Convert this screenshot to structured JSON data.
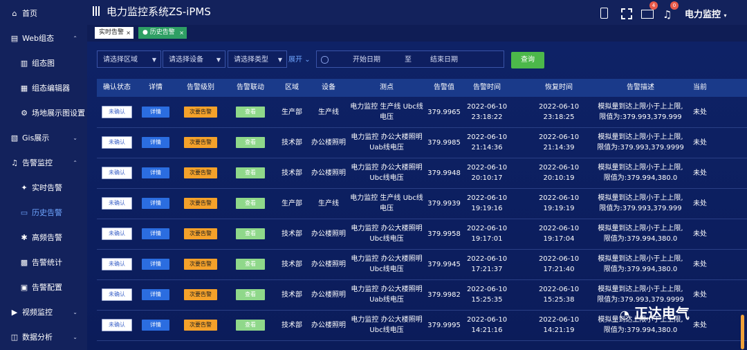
{
  "app_title": "电力监控系统ZS-iPMS",
  "user": "电力监控",
  "mail_badge": "4",
  "bell_badge": "0",
  "nav": [
    {
      "label": "首页",
      "icon": "home-icon",
      "sym": "⌂",
      "level": 0
    },
    {
      "label": "Web组态",
      "icon": "web-config-icon",
      "sym": "▤",
      "level": 0,
      "chev": "⌃"
    },
    {
      "label": "组态图",
      "icon": "diagram-icon",
      "sym": "▥",
      "level": 1
    },
    {
      "label": "组态编辑器",
      "icon": "editor-icon",
      "sym": "▦",
      "level": 1
    },
    {
      "label": "场地展示图设置",
      "icon": "gear-icon",
      "sym": "⚙",
      "level": 1
    },
    {
      "label": "Gis展示",
      "icon": "map-icon",
      "sym": "▧",
      "level": 0,
      "chev": "⌄"
    },
    {
      "label": "告警监控",
      "icon": "bell-icon",
      "sym": "♫",
      "level": 0,
      "chev": "⌃"
    },
    {
      "label": "实时告警",
      "icon": "realtime-icon",
      "sym": "✦",
      "level": 1
    },
    {
      "label": "历史告警",
      "icon": "history-icon",
      "sym": "▭",
      "level": 1,
      "active": true
    },
    {
      "label": "高频告警",
      "icon": "frequent-icon",
      "sym": "✱",
      "level": 1
    },
    {
      "label": "告警统计",
      "icon": "stats-icon",
      "sym": "▩",
      "level": 1
    },
    {
      "label": "告警配置",
      "icon": "config-icon",
      "sym": "▣",
      "level": 1
    },
    {
      "label": "视频监控",
      "icon": "video-icon",
      "sym": "▶",
      "level": 0,
      "chev": "⌄"
    },
    {
      "label": "数据分析",
      "icon": "analysis-icon",
      "sym": "◫",
      "level": 0,
      "chev": "⌄"
    }
  ],
  "tabs": [
    {
      "label": "实时告警",
      "close": "×"
    },
    {
      "label": "● 历史告警",
      "close": "×"
    }
  ],
  "filters": {
    "area": "请选择区域",
    "device": "请选择设备",
    "type": "请选择类型",
    "expand": "展开",
    "start": "开始日期",
    "to": "至",
    "end": "结束日期",
    "query": "查询"
  },
  "columns": [
    "确认状态",
    "详情",
    "告警级别",
    "告警联动",
    "区域",
    "设备",
    "测点",
    "告警值",
    "告警时间",
    "恢复时间",
    "告警描述",
    "当前"
  ],
  "rows": [
    {
      "status": "未确认",
      "detail": "详情",
      "level": "次要告警",
      "link": "查看",
      "area": "生产部",
      "device": "生产线",
      "point": "电力监控 生产线 Ubc线电压",
      "value": "379.9965",
      "time": "2022-06-10 23:18:22",
      "recover": "2022-06-10 23:18:25",
      "desc": "模拟量到达上限小于上上限,限值为:379.993,379.999",
      "cur": "未处"
    },
    {
      "status": "未确认",
      "detail": "详情",
      "level": "次要告警",
      "link": "查看",
      "area": "技术部",
      "device": "办公楼照明",
      "point": "电力监控 办公大楼照明 Uab线电压",
      "value": "379.9985",
      "time": "2022-06-10 21:14:36",
      "recover": "2022-06-10 21:14:39",
      "desc": "模拟量到达上限小于上上限,限值为:379.993,379.9999",
      "cur": "未处"
    },
    {
      "status": "未确认",
      "detail": "详情",
      "level": "次要告警",
      "link": "查看",
      "area": "技术部",
      "device": "办公楼照明",
      "point": "电力监控 办公大楼照明 Ubc线电压",
      "value": "379.9948",
      "time": "2022-06-10 20:10:17",
      "recover": "2022-06-10 20:10:19",
      "desc": "模拟量到达上限小于上上限,限值为:379.994,380.0",
      "cur": "未处"
    },
    {
      "status": "未确认",
      "detail": "详情",
      "level": "次要告警",
      "link": "查看",
      "area": "生产部",
      "device": "生产线",
      "point": "电力监控 生产线 Ubc线电压",
      "value": "379.9939",
      "time": "2022-06-10 19:19:16",
      "recover": "2022-06-10 19:19:19",
      "desc": "模拟量到达上限小于上上限,限值为:379.993,379.999",
      "cur": "未处"
    },
    {
      "status": "未确认",
      "detail": "详情",
      "level": "次要告警",
      "link": "查看",
      "area": "技术部",
      "device": "办公楼照明",
      "point": "电力监控 办公大楼照明 Ubc线电压",
      "value": "379.9958",
      "time": "2022-06-10 19:17:01",
      "recover": "2022-06-10 19:17:04",
      "desc": "模拟量到达上限小于上上限,限值为:379.994,380.0",
      "cur": "未处"
    },
    {
      "status": "未确认",
      "detail": "详情",
      "level": "次要告警",
      "link": "查看",
      "area": "技术部",
      "device": "办公楼照明",
      "point": "电力监控 办公大楼照明 Ubc线电压",
      "value": "379.9945",
      "time": "2022-06-10 17:21:37",
      "recover": "2022-06-10 17:21:40",
      "desc": "模拟量到达上限小于上上限,限值为:379.994,380.0",
      "cur": "未处"
    },
    {
      "status": "未确认",
      "detail": "详情",
      "level": "次要告警",
      "link": "查看",
      "area": "技术部",
      "device": "办公楼照明",
      "point": "电力监控 办公大楼照明 Uab线电压",
      "value": "379.9982",
      "time": "2022-06-10 15:25:35",
      "recover": "2022-06-10 15:25:38",
      "desc": "模拟量到达上限小于上上限,限值为:379.993,379.9999",
      "cur": "未处"
    },
    {
      "status": "未确认",
      "detail": "详情",
      "level": "次要告警",
      "link": "查看",
      "area": "技术部",
      "device": "办公楼照明",
      "point": "电力监控 办公大楼照明 Ubc线电压",
      "value": "379.9995",
      "time": "2022-06-10 14:21:16",
      "recover": "2022-06-10 14:21:19",
      "desc": "模拟量到达上限小于上上限,限值为:379.994,380.0",
      "cur": "未处"
    }
  ],
  "watermark": "正达电气"
}
